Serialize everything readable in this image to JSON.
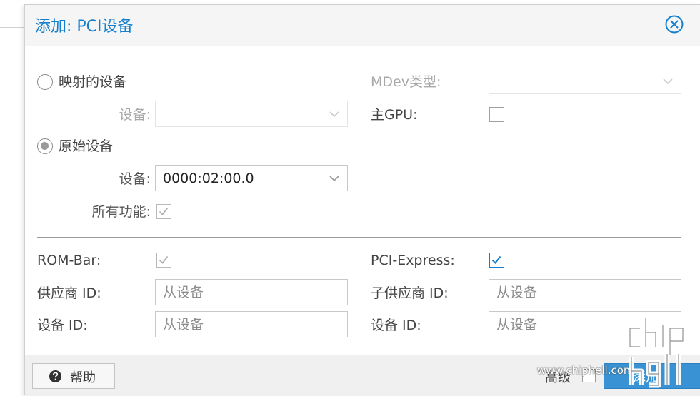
{
  "dialog": {
    "title": "添加: PCI设备"
  },
  "mapped": {
    "radio_label": "映射的设备",
    "device_label": "设备:",
    "device_value": ""
  },
  "raw": {
    "radio_label": "原始设备",
    "device_label": "设备:",
    "device_value": "0000:02:00.0",
    "all_functions_label": "所有功能:"
  },
  "mdev": {
    "label": "MDev类型:",
    "value": ""
  },
  "primary_gpu": {
    "label": "主GPU:"
  },
  "advanced": {
    "rombar_label": "ROM-Bar:",
    "pcie_label": "PCI-Express:",
    "vendor_id_label": "供应商 ID:",
    "vendor_id_placeholder": "从设备",
    "sub_vendor_id_label": "子供应商 ID:",
    "sub_vendor_id_placeholder": "从设备",
    "device_id_label": "设备 ID:",
    "device_id_placeholder": "从设备",
    "sub_device_id_label": "设备 ID:",
    "sub_device_id_placeholder": "从设备"
  },
  "footer": {
    "help_label": "帮助",
    "advanced_label": "高级",
    "add_label": "添加"
  },
  "watermark": {
    "text": "www.chiphell.com",
    "logo_text": "chip hell"
  },
  "colors": {
    "accent": "#157fcc",
    "primary_button": "#3892d4"
  },
  "icons": {
    "close": "close-circle-icon",
    "help": "question-circle-icon",
    "dropdown": "chevron-down-icon",
    "check": "check-icon"
  }
}
